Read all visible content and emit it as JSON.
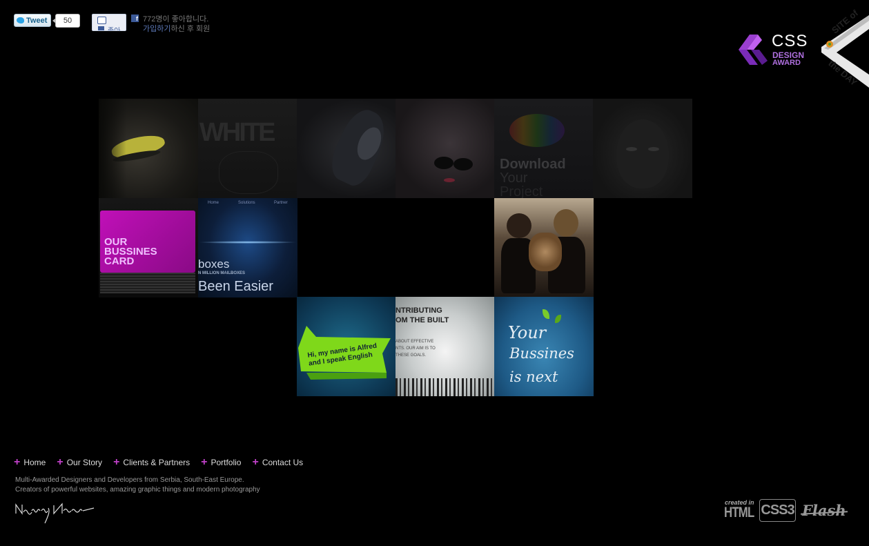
{
  "social": {
    "tweet_label": "Tweet",
    "tweet_count": "50",
    "fb_like_label": "좋아요",
    "fb_icon": "f",
    "fb_count_text": "772명이 좋아합니다.",
    "fb_signup_link": "가입하기",
    "fb_signup_rest": "하신 후 회원"
  },
  "awards": {
    "css_word": "CSS",
    "css_design": "DESIGN",
    "css_award": "AWARD",
    "sotd_line1": "SITE of",
    "sotd_line2": "the DAY"
  },
  "portfolio": {
    "tiles": [
      {
        "name": "tile-yellow-lips"
      },
      {
        "name": "tile-white",
        "text": "WHITE"
      },
      {
        "name": "tile-dark-figure"
      },
      {
        "name": "tile-sunglasses"
      },
      {
        "name": "tile-download",
        "text1": "Download",
        "text2": "Your",
        "text3": "Project"
      },
      {
        "name": "tile-dark-face"
      },
      {
        "name": "tile-business-card",
        "text1": "OUR",
        "text2": "BUSSINES",
        "text3": "CARD"
      },
      {
        "name": "tile-mailboxes",
        "nav1": "Home",
        "nav2": "Solutions",
        "nav3": "Partner",
        "text1": "boxes",
        "text2": "N MILLION MAILBOXES",
        "text3": "Been Easier"
      },
      {
        "name": "tile-two-women"
      },
      {
        "name": "tile-alfred",
        "text": "Hi, my name is Alfred and I speak English"
      },
      {
        "name": "tile-contributing",
        "text1": "NTRIBUTING",
        "text2": "OM THE BUILT",
        "text3": "ABOUT EFFECTIVE",
        "text4": "NTS. OUR AIM IS TO",
        "text5": "THESE GOALS."
      },
      {
        "name": "tile-your-business",
        "text1": "Your",
        "text2": "Bussines",
        "text3": "is next"
      }
    ]
  },
  "footer": {
    "nav": [
      "Home",
      "Our Story",
      "Clients & Partners",
      "Portfolio",
      "Contact Us"
    ],
    "tagline1": "Multi-Awarded Designers and Developers from Serbia, South-East Europe.",
    "tagline2": "Creators of powerful websites, amazing graphic things and modern photography",
    "created_in": "created in",
    "html": "HTML",
    "css3": "CSS3",
    "flash": "Flash"
  },
  "colors": {
    "background": "#000000",
    "accent": "#c040c8",
    "css_award_purple": "#b070e0"
  }
}
